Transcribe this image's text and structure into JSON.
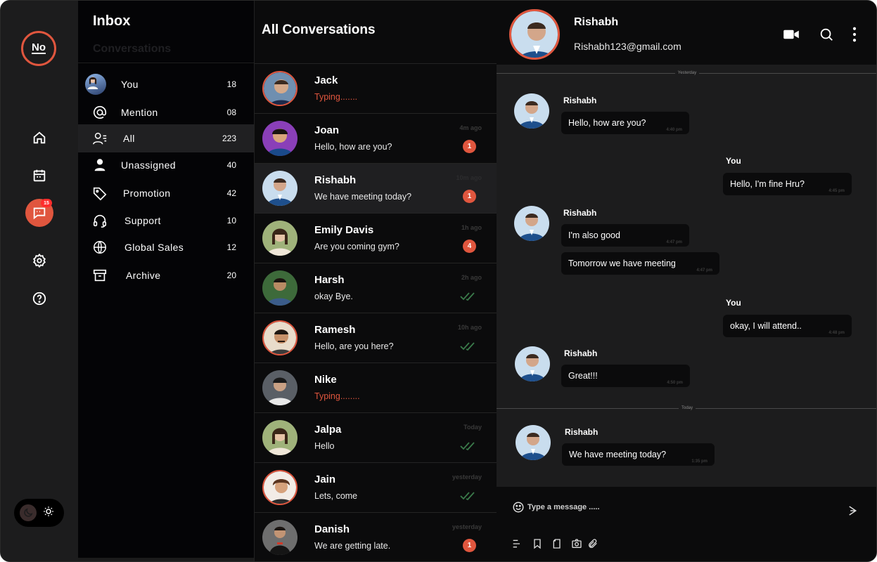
{
  "rail": {
    "logo_text": "No",
    "chat_badge": "15",
    "icons": [
      "home-icon",
      "calendar-icon",
      "chat-icon",
      "settings-icon",
      "help-icon"
    ],
    "theme_icons": [
      "moon-icon",
      "sun-icon"
    ]
  },
  "inbox": {
    "title": "Inbox",
    "subtitle": "Conversations",
    "items": [
      {
        "label": "You",
        "count": "18",
        "icon": "user-avatar"
      },
      {
        "label": "Mention",
        "count": "08",
        "icon": "at-icon"
      },
      {
        "label": "All",
        "count": "223",
        "icon": "users-list-icon"
      },
      {
        "label": "Unassigned",
        "count": "40",
        "icon": "user-icon"
      },
      {
        "label": "Promotion",
        "count": "42",
        "icon": "tag-icon"
      },
      {
        "label": "Support",
        "count": "10",
        "icon": "headset-icon"
      },
      {
        "label": "Global Sales",
        "count": "12",
        "icon": "globe-icon"
      },
      {
        "label": "Archive",
        "count": "20",
        "icon": "archive-icon"
      }
    ]
  },
  "conversations": {
    "title": "All Conversations",
    "items": [
      {
        "name": "Jack",
        "message": "Typing.......",
        "time": "",
        "unread": "",
        "status": "typing"
      },
      {
        "name": "Joan",
        "message": "Hello, how  are you?",
        "time": "4m ago",
        "unread": "1",
        "status": "unread"
      },
      {
        "name": "Rishabh",
        "message": "We have meeting today?",
        "time": "10m ago",
        "unread": "1",
        "status": "unread"
      },
      {
        "name": "Emily Davis",
        "message": "Are you coming gym?",
        "time": "1h ago",
        "unread": "4",
        "status": "unread"
      },
      {
        "name": "Harsh",
        "message": "okay Bye.",
        "time": "2h  ago",
        "unread": "",
        "status": "read"
      },
      {
        "name": "Ramesh",
        "message": "Hello, are you here?",
        "time": "10h ago",
        "unread": "",
        "status": "read"
      },
      {
        "name": "Nike",
        "message": "Typing........",
        "time": "",
        "unread": "",
        "status": "typing"
      },
      {
        "name": "Jalpa",
        "message": "Hello",
        "time": "Today",
        "unread": "",
        "status": "read"
      },
      {
        "name": "Jain",
        "message": "Lets, come",
        "time": "yesterday",
        "unread": "",
        "status": "read"
      },
      {
        "name": "Danish",
        "message": "We are getting late.",
        "time": "yesterday",
        "unread": "1",
        "status": "unread"
      }
    ]
  },
  "chat": {
    "contact_name": "Rishabh",
    "contact_email": "Rishabh123@gmail.com",
    "header_icons": [
      "video-call-icon",
      "search-icon",
      "more-vertical-icon"
    ],
    "separators": [
      "Yesterday",
      "Today"
    ],
    "messages": [
      {
        "sender": "Rishabh",
        "text": "Hello, how  are you?",
        "time": "4:40 pm",
        "side": "left"
      },
      {
        "sender": "You",
        "text": "Hello, I'm fine Hru?",
        "time": "4:45 pm",
        "side": "right"
      },
      {
        "sender": "Rishabh",
        "text": "I'm also good",
        "time": "4:47 pm",
        "side": "left"
      },
      {
        "sender": "",
        "text": "Tomorrow we have meeting",
        "time": "4:47 pm",
        "side": "left"
      },
      {
        "sender": "You",
        "text": "okay, I will attend..",
        "time": "4:48 pm",
        "side": "right"
      },
      {
        "sender": "Rishabh",
        "text": "Great!!!",
        "time": "4:50 pm",
        "side": "left"
      },
      {
        "sender": "Rishabh",
        "text": "We have meeting today?",
        "time": "1:35 pm",
        "side": "left"
      }
    ],
    "composer": {
      "placeholder": "Type a message .....",
      "icons": [
        "emoji-icon",
        "send-icon",
        "text-format-icon",
        "bookmark-icon",
        "document-icon",
        "camera-icon",
        "attachment-icon"
      ]
    }
  },
  "colors": {
    "accent": "#e0563e",
    "background": "#0b0b0c",
    "panel": "#1c1c1d",
    "read_ticks": "#3a7a4a"
  }
}
